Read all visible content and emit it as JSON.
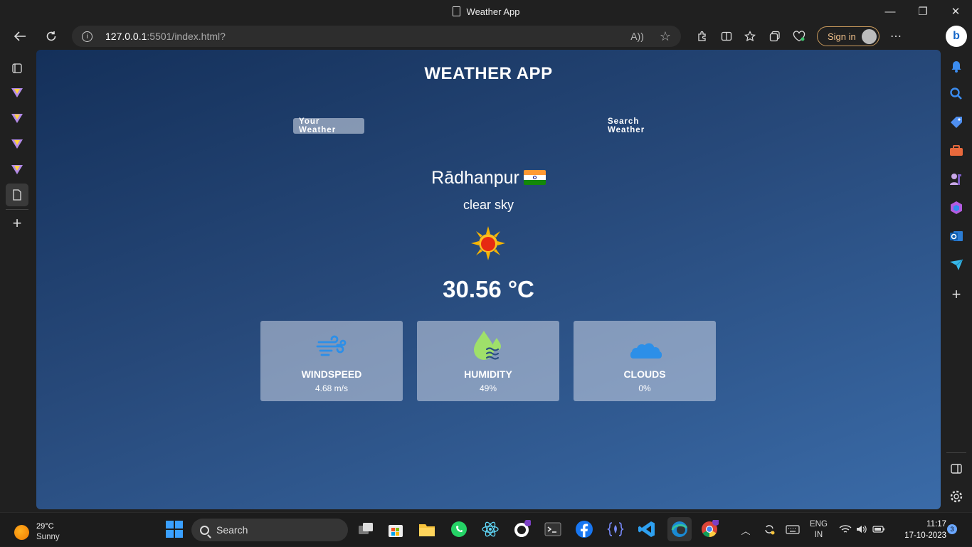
{
  "window": {
    "title": "Weather App",
    "minimize_glyph": "—",
    "maximize_glyph": "❐",
    "close_glyph": "✕"
  },
  "browser": {
    "url_host": "127.0.0.1",
    "url_rest": ":5501/index.html?",
    "back_icon": "arrow-left-icon",
    "refresh_icon": "refresh-icon",
    "read_aloud_glyph": "A))",
    "favorite_glyph": "☆",
    "sign_in_label": "Sign in",
    "more_glyph": "⋯",
    "bing_glyph": "b"
  },
  "app": {
    "title": "WEATHER APP",
    "tabs": {
      "your_weather": "Your Weather",
      "search_weather": "Search Weather"
    },
    "city": "Rādhanpur",
    "country": "IN",
    "description": "clear sky",
    "temperature": "30.56 °C",
    "cards": {
      "windspeed": {
        "label": "WINDSPEED",
        "value": "4.68 m/s"
      },
      "humidity": {
        "label": "HUMIDITY",
        "value": "49%"
      },
      "clouds": {
        "label": "CLOUDS",
        "value": "0%"
      }
    }
  },
  "taskbar": {
    "weather_temp": "29°C",
    "weather_cond": "Sunny",
    "search_label": "Search",
    "lang_1": "ENG",
    "lang_2": "IN",
    "time": "11:17",
    "date": "17-10-2023",
    "notification_count": "3"
  }
}
